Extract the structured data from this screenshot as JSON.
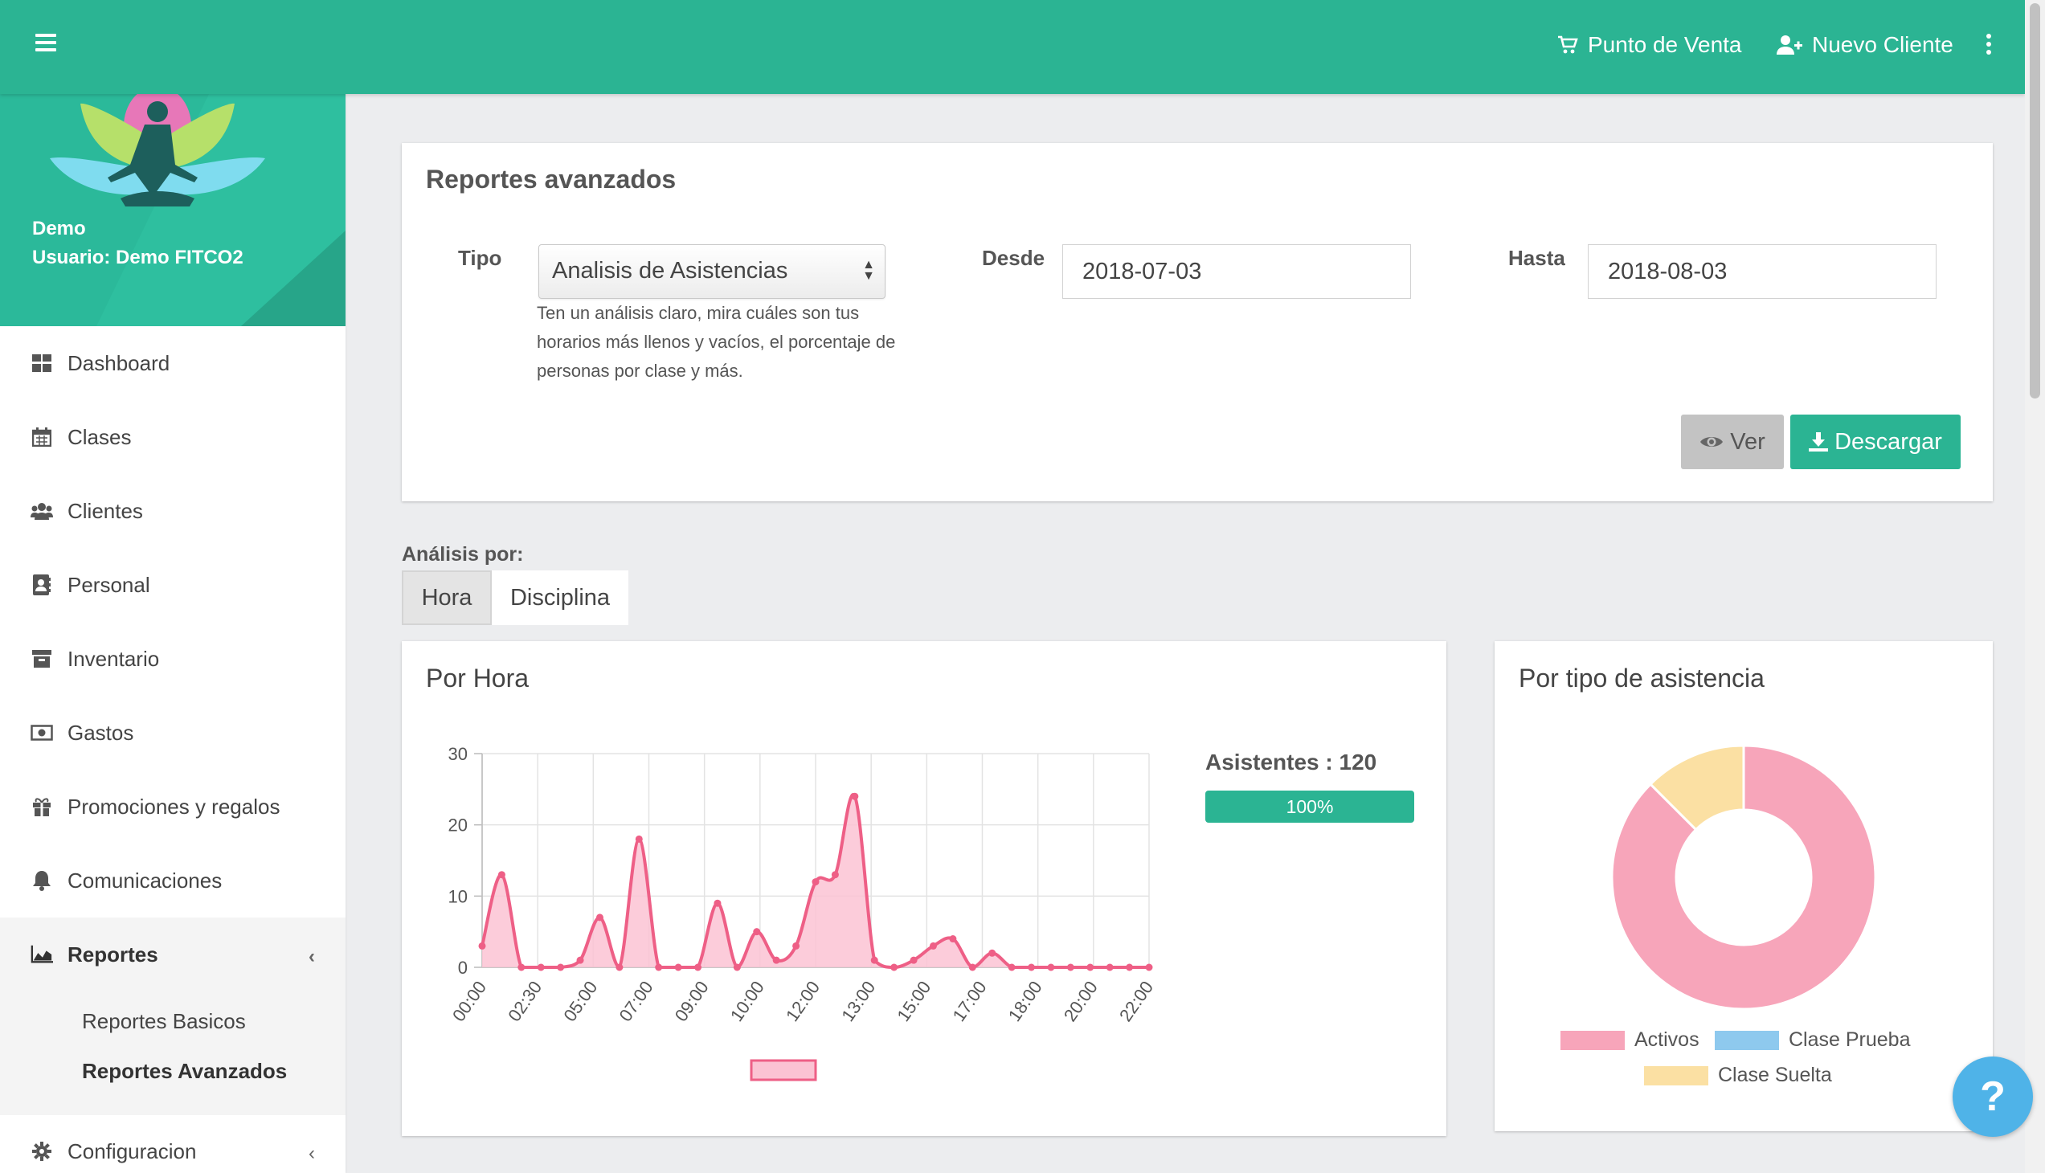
{
  "header": {
    "pos_label": "Punto de Venta",
    "new_client_label": "Nuevo Cliente"
  },
  "sidebar": {
    "account_name": "Demo",
    "user_label": "Usuario: Demo FITCO2",
    "items": [
      {
        "label": "Dashboard",
        "icon": "dashboard-icon"
      },
      {
        "label": "Clases",
        "icon": "calendar-icon"
      },
      {
        "label": "Clientes",
        "icon": "users-icon"
      },
      {
        "label": "Personal",
        "icon": "contact-book-icon"
      },
      {
        "label": "Inventario",
        "icon": "archive-icon"
      },
      {
        "label": "Gastos",
        "icon": "money-icon"
      },
      {
        "label": "Promociones y regalos",
        "icon": "gift-icon"
      },
      {
        "label": "Comunicaciones",
        "icon": "bell-icon"
      },
      {
        "label": "Reportes",
        "icon": "area-chart-icon"
      },
      {
        "label": "Configuracion",
        "icon": "gear-icon"
      }
    ],
    "submenu": [
      "Reportes Basicos",
      "Reportes Avanzados"
    ]
  },
  "report": {
    "title": "Reportes avanzados",
    "tipo_label": "Tipo",
    "tipo_value": "Analisis de Asistencias",
    "tipo_help": "Ten un análisis claro, mira cuáles son tus horarios más llenos y vacíos, el porcentaje de personas por clase y más.",
    "desde_label": "Desde",
    "desde_value": "2018-07-03",
    "hasta_label": "Hasta",
    "hasta_value": "2018-08-03",
    "ver_label": "Ver",
    "descargar_label": "Descargar"
  },
  "analysis": {
    "label": "Análisis por:",
    "tabs": [
      "Hora",
      "Disciplina"
    ],
    "active_tab": "Hora"
  },
  "hour_chart": {
    "title": "Por Hora",
    "attendees_label": "Asistentes : 120",
    "progress_percent": 100,
    "progress_label": "100%"
  },
  "type_chart": {
    "title": "Por tipo de asistencia"
  },
  "help_fab": "?",
  "colors": {
    "brand": "#2bb493",
    "line": "#ee5f86",
    "fill": "#fbc3d3",
    "donut_activos": "#f7a5ba",
    "donut_prueba": "#8ec9ee",
    "donut_suelta": "#fbe0a3"
  },
  "chart_data": [
    {
      "type": "area",
      "title": "Por Hora",
      "xlabel": "",
      "ylabel": "",
      "ylim": [
        0,
        30
      ],
      "yticks": [
        0,
        10,
        20,
        30
      ],
      "grid": true,
      "x": [
        "00:00",
        "01:00",
        "02:00",
        "02:30",
        "03:00",
        "04:00",
        "05:00",
        "06:00",
        "06:30",
        "07:00",
        "08:00",
        "08:30",
        "09:00",
        "09:30",
        "10:00",
        "10:30",
        "11:00",
        "11:30",
        "12:00",
        "12:30",
        "13:00",
        "14:00",
        "15:00",
        "16:00",
        "16:30",
        "17:00",
        "17:30",
        "18:00",
        "18:30",
        "19:00",
        "20:00",
        "20:30",
        "21:00",
        "22:00",
        "22:30"
      ],
      "x_tick_labels": [
        "00:00",
        "02:30",
        "05:00",
        "07:00",
        "09:00",
        "10:00",
        "12:00",
        "13:00",
        "15:00",
        "17:00",
        "18:00",
        "20:00",
        "22:00"
      ],
      "series": [
        {
          "values": [
            3,
            13,
            0,
            0,
            0,
            1,
            7,
            0,
            18,
            0,
            0,
            0,
            9,
            0,
            5,
            1,
            3,
            12,
            13,
            24,
            1,
            0,
            1,
            3,
            4,
            0,
            2,
            0,
            0,
            0,
            0,
            0,
            0,
            0,
            0
          ]
        }
      ]
    },
    {
      "type": "pie",
      "title": "Por tipo de asistencia",
      "donut": true,
      "categories": [
        "Activos",
        "Clase Prueba",
        "Clase Suelta"
      ],
      "values": [
        105,
        0,
        15
      ],
      "legend": "bottom"
    }
  ]
}
